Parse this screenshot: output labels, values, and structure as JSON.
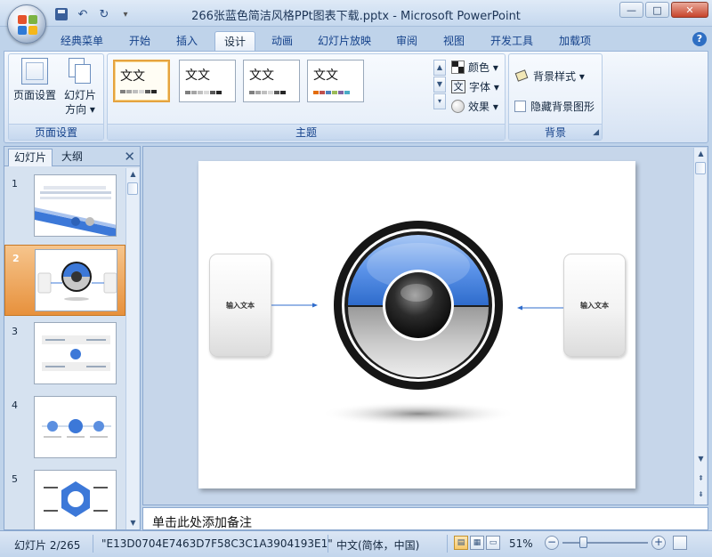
{
  "window": {
    "title": "266张蓝色简洁风格PPt图表下载.pptx - Microsoft PowerPoint",
    "minimize": "—",
    "maximize": "□",
    "close": "✕"
  },
  "quick_access": {
    "undo": "↶",
    "redo": "↻",
    "customize": "▾"
  },
  "tabs": [
    {
      "label": "经典菜单",
      "active": false
    },
    {
      "label": "开始",
      "active": false
    },
    {
      "label": "插入",
      "active": false
    },
    {
      "label": "设计",
      "active": true
    },
    {
      "label": "动画",
      "active": false
    },
    {
      "label": "幻灯片放映",
      "active": false
    },
    {
      "label": "审阅",
      "active": false
    },
    {
      "label": "视图",
      "active": false
    },
    {
      "label": "开发工具",
      "active": false
    },
    {
      "label": "加载项",
      "active": false
    }
  ],
  "help": "?",
  "ribbon": {
    "page_setup": {
      "group_label": "页面设置",
      "page_setup_label": "页面设置",
      "orientation_label_1": "幻灯片",
      "orientation_label_2": "方向 ▾"
    },
    "themes": {
      "group_label": "主题",
      "items": [
        {
          "label": "文文",
          "swatch": [
            "#1f4e79",
            "#4f81bd",
            "#c0504d",
            "#9bbb59",
            "#8064a2",
            "#4bacc6"
          ]
        },
        {
          "label": "文文",
          "swatch": [
            "#7f7f7f",
            "#a5a5a5",
            "#bfbfbf",
            "#d9d9d9",
            "#595959",
            "#262626"
          ]
        },
        {
          "label": "文文",
          "swatch": [
            "#7f7f7f",
            "#a5a5a5",
            "#bfbfbf",
            "#d9d9d9",
            "#595959",
            "#262626"
          ]
        },
        {
          "label": "文文",
          "swatch": [
            "#e36c09",
            "#c0504d",
            "#4f81bd",
            "#9bbb59",
            "#8064a2",
            "#4bacc6"
          ]
        }
      ],
      "colors_label": "颜色 ▾",
      "fonts_label": "字体 ▾",
      "effects_label": "效果 ▾",
      "fonts_glyph": "文"
    },
    "background": {
      "group_label": "背景",
      "styles_label": "背景样式 ▾",
      "hide_graphics_label": "隐藏背景图形",
      "hide_graphics_checked": false
    }
  },
  "slides_panel": {
    "tab_slides": "幻灯片",
    "tab_outline": "大纲",
    "close": "✕",
    "thumbnails": [
      {
        "number": "1"
      },
      {
        "number": "2"
      },
      {
        "number": "3"
      },
      {
        "number": "4"
      },
      {
        "number": "5"
      }
    ],
    "selected_number": "2"
  },
  "slide": {
    "left_text": "输入文本",
    "right_text": "输入文本",
    "colors": {
      "accent_blue": "#3c78d8",
      "ring_dark": "#1a1a1a",
      "gray": "#bcbcbc"
    }
  },
  "notes": {
    "placeholder": "单击此处添加备注"
  },
  "status": {
    "slide_position": "幻灯片 2/265",
    "theme_name": "\"E13D0704E7463D7F58C3C1A3904193E1\"",
    "language": "中文(简体，中国)",
    "zoom": "51%",
    "zoom_out": "−",
    "zoom_in": "+"
  }
}
